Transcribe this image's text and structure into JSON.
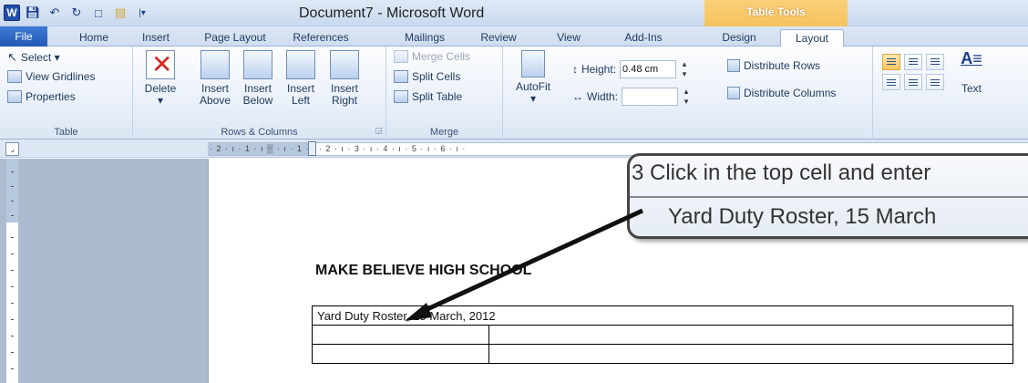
{
  "window": {
    "title": "Document7 - Microsoft Word",
    "contextual_group": "Table Tools"
  },
  "qat": {
    "app_icon": "W",
    "icons": [
      "save-icon",
      "undo-icon",
      "redo-icon",
      "new-document-icon",
      "open-folder-icon",
      "customize-dropdown-icon"
    ]
  },
  "tabs": {
    "file": "File",
    "home": "Home",
    "insert": "Insert",
    "page_layout": "Page Layout",
    "references": "References",
    "mailings": "Mailings",
    "review": "Review",
    "view": "View",
    "add_ins": "Add-Ins",
    "design": "Design",
    "layout": "Layout"
  },
  "ribbon": {
    "table": {
      "select": "Select ▾",
      "view_gridlines": "View Gridlines",
      "properties": "Properties",
      "label": "Table"
    },
    "rows_columns": {
      "delete": "Delete",
      "delete_arrow": "▾",
      "insert_above_1": "Insert",
      "insert_above_2": "Above",
      "insert_below_1": "Insert",
      "insert_below_2": "Below",
      "insert_left_1": "Insert",
      "insert_left_2": "Left",
      "insert_right_1": "Insert",
      "insert_right_2": "Right",
      "label": "Rows & Columns"
    },
    "merge": {
      "merge_cells": "Merge Cells",
      "split_cells": "Split Cells",
      "split_table": "Split Table",
      "label": "Merge"
    },
    "cell_size": {
      "autofit": "AutoFit",
      "autofit_arrow": "▾",
      "height_label": "Height:",
      "height_value": "0.48 cm",
      "width_label": "Width:",
      "width_value": "",
      "distribute_rows": "Distribute Rows",
      "distribute_columns": "Distribute Columns"
    },
    "alignment": {
      "text_direction": "Text"
    }
  },
  "ruler": {
    "corner": "⌟",
    "numbers": "· 2 · ı · 1 · ı ▒ · ı · 1 · ı · 2 · ı · 3 · ı · 4 · ı · 5 · ı · 6 · ı ·"
  },
  "document": {
    "heading": "MAKE BELIEVE HIGH SCHOOL",
    "table_rows": [
      [
        "Yard Duty Roster, 15 March, 2012"
      ],
      [
        "",
        ""
      ],
      [
        "",
        ""
      ]
    ]
  },
  "callout": {
    "line1": "3 Click in the top cell and enter",
    "line2": "Yard Duty Roster, 15 March"
  }
}
